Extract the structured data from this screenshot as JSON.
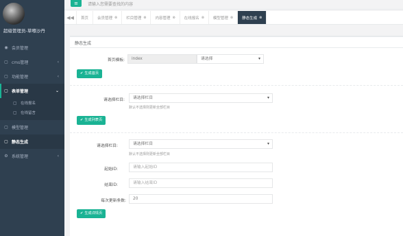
{
  "sidebar": {
    "username": "超级管理员-草嘟沙丹",
    "items": [
      {
        "label": "会员管理",
        "icon": "user-icon",
        "glyph": "◉",
        "has_chevron": false
      },
      {
        "label": "cms管理",
        "icon": "file-icon",
        "glyph": "▢",
        "has_chevron": true
      },
      {
        "label": "功能管理",
        "icon": "file-icon",
        "glyph": "▢",
        "has_chevron": true
      },
      {
        "label": "表单管理",
        "icon": "file-icon",
        "glyph": "▢",
        "has_chevron": true
      }
    ],
    "subitems": [
      {
        "label": "在线报名",
        "glyph": "▢"
      },
      {
        "label": "在线留言",
        "glyph": "▢"
      }
    ],
    "items2": [
      {
        "label": "模型管理",
        "glyph": "▢",
        "has_chevron": false
      },
      {
        "label": "静态生成",
        "glyph": "▢",
        "has_chevron": false
      },
      {
        "label": "系统管理",
        "glyph": "⚙",
        "has_chevron": true
      }
    ],
    "chevron": "‹",
    "open_chevron": "⌄"
  },
  "topbar": {
    "menu_glyph": "≡",
    "search_hint": "请输入您需要查找的内容"
  },
  "tabs": {
    "arrow": "◀◀",
    "items": [
      {
        "label": "首页",
        "close": ""
      },
      {
        "label": "会员管理",
        "close": "⊗"
      },
      {
        "label": "栏目管理",
        "close": "⊗"
      },
      {
        "label": "内容管理",
        "close": "⊗"
      },
      {
        "label": "在线报名",
        "close": "⊗"
      },
      {
        "label": "模型管理",
        "close": "⊗"
      },
      {
        "label": "静态生成",
        "close": "⊗"
      }
    ]
  },
  "panel": {
    "title": "静态生成",
    "home": {
      "template_label": "首页模板:",
      "template_value": "index",
      "select_value": "请选择",
      "button": "生成首页"
    },
    "column": {
      "label": "请选择栏目:",
      "select_value": "请选择栏目",
      "hint": "默认不选择则更新全部栏目",
      "button": "生成列表页"
    },
    "detail": {
      "label": "请选择栏目:",
      "select_value": "请选择栏目",
      "hint": "默认不选择则更新全部栏目",
      "start_label": "起始ID:",
      "start_placeholder": "请输入起始ID",
      "end_label": "结束ID:",
      "end_placeholder": "请输入结束ID",
      "count_label": "每次更新条数:",
      "count_value": "20",
      "button": "生成详情页"
    },
    "check_glyph": "✔"
  },
  "colors": {
    "sidebar_bg": "#2f4050",
    "accent": "#1ab394",
    "active_tab": "#2f4050"
  }
}
